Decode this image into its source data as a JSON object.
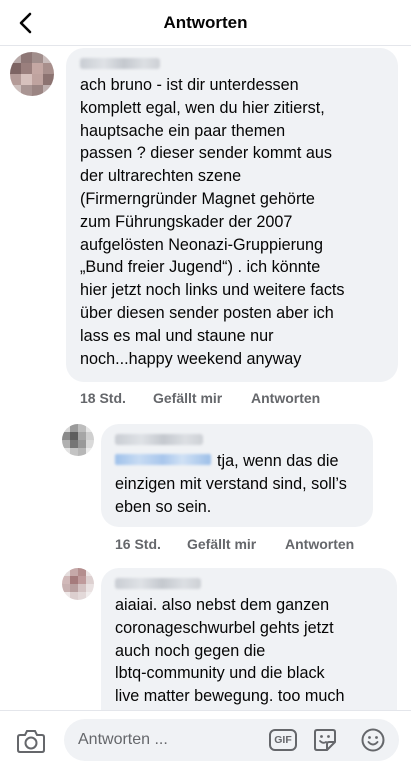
{
  "header": {
    "title": "Antworten",
    "back_icon": "chevron-left-icon"
  },
  "comments": [
    {
      "text": "ach bruno - ist dir unterdessen\nkomplett egal, wen du hier zitierst,\nhauptsache ein paar themen\npassen ? dieser sender kommt aus\nder ultrarechten szene\n(Firmerngründer Magnet gehörte\nzum Führungskader der 2007\naufgelösten Neonazi-Gruppierung\n„Bund freier Jugend“) . ich könnte\nhier jetzt noch links und weitere facts\nüber diesen sender posten aber ich\nlass es mal und staune nur\nnoch...happy weekend anyway",
      "time": "18 Std.",
      "like": "Gefällt mir",
      "reply": "Antworten"
    },
    {
      "text": "tja, wenn das die\neinzigen mit verstand sind, soll’s\neben so sein.",
      "time": "16 Std.",
      "like": "Gefällt mir",
      "reply": "Antworten"
    },
    {
      "text": "aiaiai. also nebst dem ganzen\ncoronageschwurbel gehts jetzt\nauch noch gegen die\nlbtq-community und die black\nlive matter bewegung. too much"
    }
  ],
  "composer": {
    "placeholder": "Antworten ...",
    "gif_label": "GIF",
    "camera_icon": "camera-icon",
    "sticker_icon": "sticker-icon",
    "emoji_icon": "emoji-icon"
  },
  "colors": {
    "bubble": "#f0f2f5",
    "meta_text": "#65676b",
    "mention_blur": "#a8c6ec"
  }
}
